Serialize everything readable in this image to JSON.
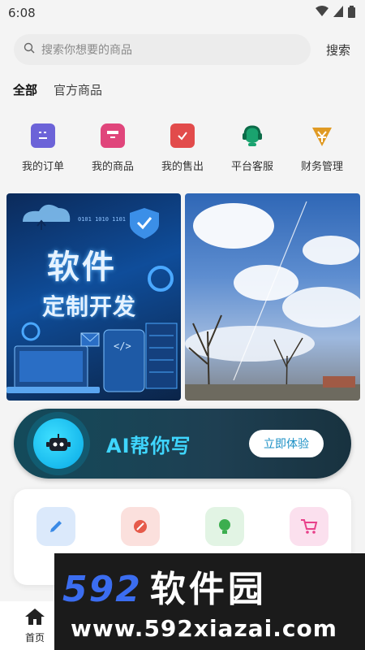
{
  "status": {
    "time": "6:08"
  },
  "search": {
    "placeholder": "搜索你想要的商品",
    "button": "搜索"
  },
  "tabs": [
    {
      "label": "全部",
      "active": true
    },
    {
      "label": "官方商品",
      "active": false
    }
  ],
  "shortcuts": [
    {
      "label": "我的订单",
      "icon": "order-list-icon",
      "color": "#6c63d8"
    },
    {
      "label": "我的商品",
      "icon": "shop-icon",
      "color": "#e0457b"
    },
    {
      "label": "我的售出",
      "icon": "sold-check-icon",
      "color": "#e24b4b"
    },
    {
      "label": "平台客服",
      "icon": "headset-icon",
      "color": "#1aa36f"
    },
    {
      "label": "财务管理",
      "icon": "finance-icon",
      "color": "#e09a23"
    }
  ],
  "cards": {
    "left": {
      "title": "软件",
      "subtitle": "定制开发",
      "binary": "0101 1010 1101"
    },
    "right": {}
  },
  "ai_banner": {
    "title": "AI帮你写",
    "button": "立即体验"
  },
  "tools": [
    {
      "icon": "pencil-icon",
      "color": "#dbe9fb",
      "icon_color": "#3a8ae6"
    },
    {
      "icon": "tag-discount-icon",
      "color": "#fbe0dd",
      "icon_color": "#e65a4a"
    },
    {
      "icon": "ai-bulb-icon",
      "color": "#e2f4e4",
      "icon_color": "#3cae4f"
    },
    {
      "icon": "cart-icon",
      "color": "#fbe0ee",
      "icon_color": "#e8408a"
    }
  ],
  "bottom_nav": {
    "home_label": "首页"
  },
  "watermark": {
    "line1_digits": "592",
    "line1_cn": "软件园",
    "line2": "www.592xiazai.com"
  }
}
